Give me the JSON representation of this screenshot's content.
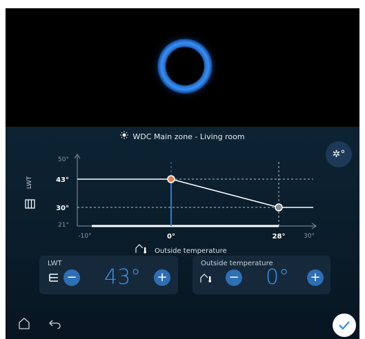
{
  "zone": {
    "title": "WDC Main zone - Living room"
  },
  "chart_data": {
    "type": "line",
    "xlabel": "Outside temperature",
    "ylabel": "LWT",
    "x_ticks": [
      "-10°",
      "0°",
      "28°",
      "30°"
    ],
    "y_ticks": [
      "50°",
      "43°",
      "30°",
      "21°"
    ],
    "xlim": [
      -10,
      30
    ],
    "ylim": [
      21,
      50
    ],
    "points": [
      {
        "x": -10,
        "y": 43
      },
      {
        "x": 0,
        "y": 43
      },
      {
        "x": 28,
        "y": 30
      },
      {
        "x": 30,
        "y": 30
      }
    ],
    "current_outside": 0,
    "colors": {
      "line": "#ffffff",
      "point_active": "#e0824a",
      "point_end": "#8d8d8d",
      "marker": "#2b7fd8"
    }
  },
  "panels": {
    "lwt": {
      "label": "LWT",
      "value": "43°",
      "minus": "−",
      "plus": "+"
    },
    "outside": {
      "label": "Outside temperature",
      "value": "0°",
      "minus": "−",
      "plus": "+"
    }
  },
  "icons": {
    "mode": "sun-snowflake-icon",
    "home": "home-icon",
    "back": "back-icon",
    "confirm": "check-icon"
  }
}
